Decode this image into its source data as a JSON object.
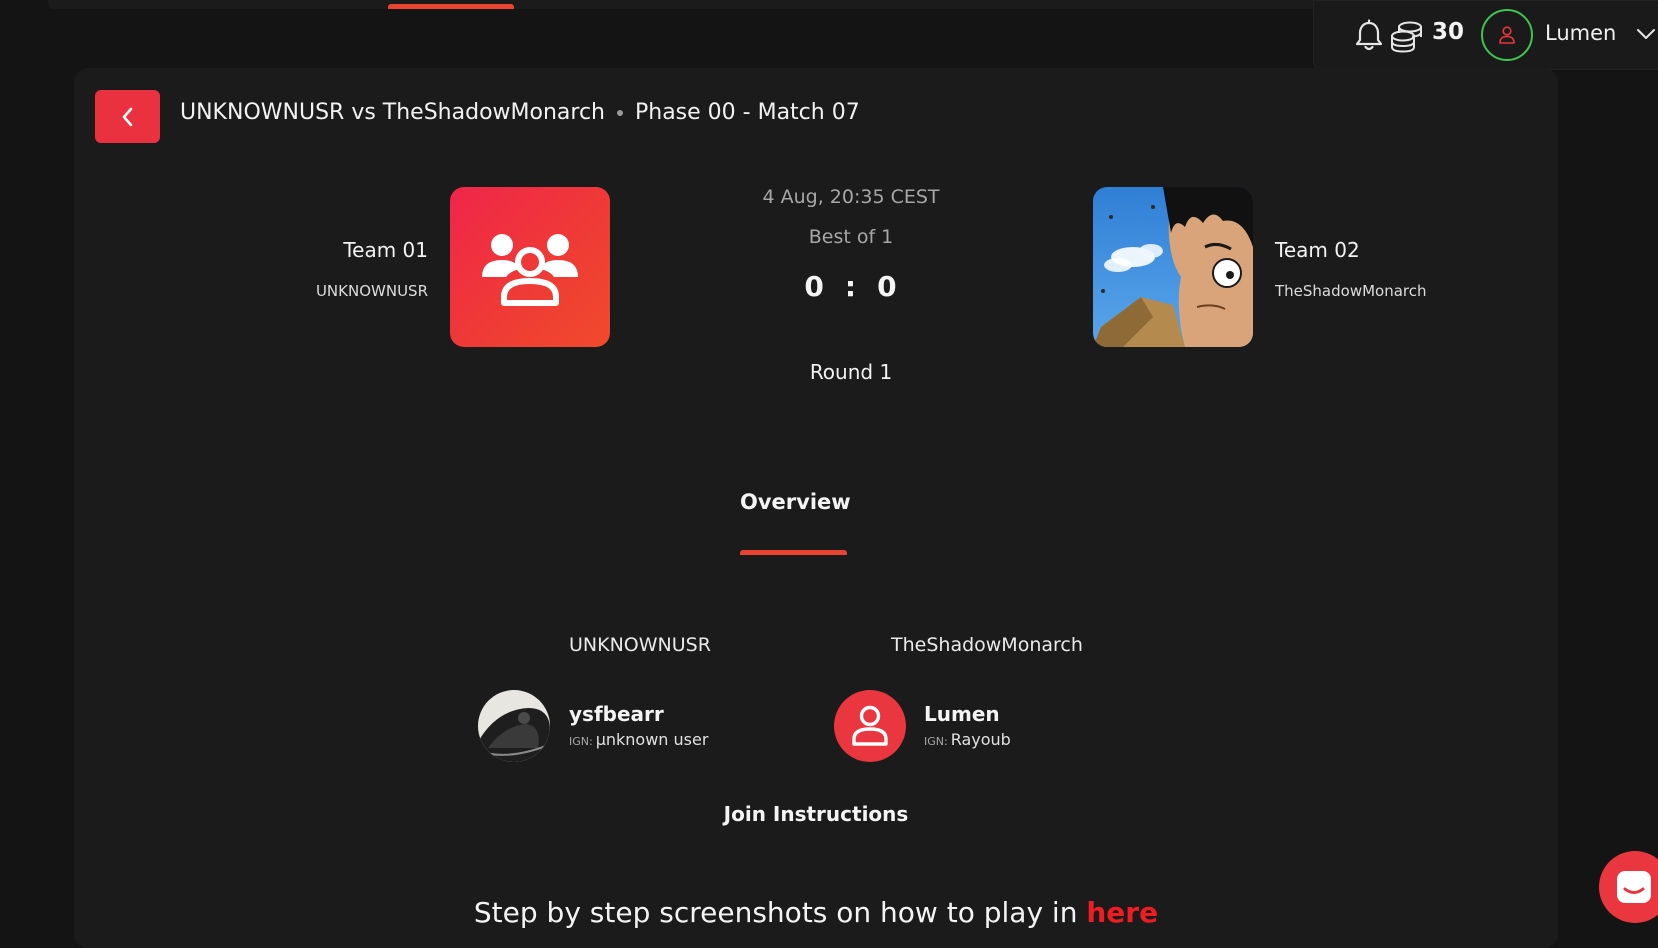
{
  "header": {
    "coin_count": "30",
    "username": "Lumen",
    "accent_color": "#e8442f",
    "online_color": "#3fc44f"
  },
  "match": {
    "title": "UNKNOWNUSR vs TheShadowMonarch",
    "phase": "Phase 00 - Match 07",
    "date": "4 Aug, 20:35 CEST",
    "best_of": "Best of 1",
    "score_left": "0",
    "score_sep": ":",
    "score_right": "0",
    "round": "Round 1"
  },
  "team1": {
    "name": "Team 01",
    "subtitle": "UNKNOWNUSR",
    "logo_icon": "team-group-icon"
  },
  "team2": {
    "name": "Team 02",
    "subtitle": "TheShadowMonarch",
    "logo_icon": "anime-character-avatar"
  },
  "tabs": [
    {
      "label": "Overview",
      "active": true
    }
  ],
  "rosters": [
    {
      "team": "UNKNOWNUSR",
      "players": [
        {
          "name": "ysfbearr",
          "ign_label": "IGN:",
          "ign": "µnknown user",
          "avatar": "photo-avatar"
        }
      ]
    },
    {
      "team": "TheShadowMonarch",
      "players": [
        {
          "name": "Lumen",
          "ign_label": "IGN:",
          "ign": "Rayoub",
          "avatar": "user-icon"
        }
      ]
    }
  ],
  "join": {
    "title": "Join Instructions",
    "text": "Step by step screenshots on how to play in ",
    "link_text": "here",
    "link_color": "#ef1c22"
  }
}
